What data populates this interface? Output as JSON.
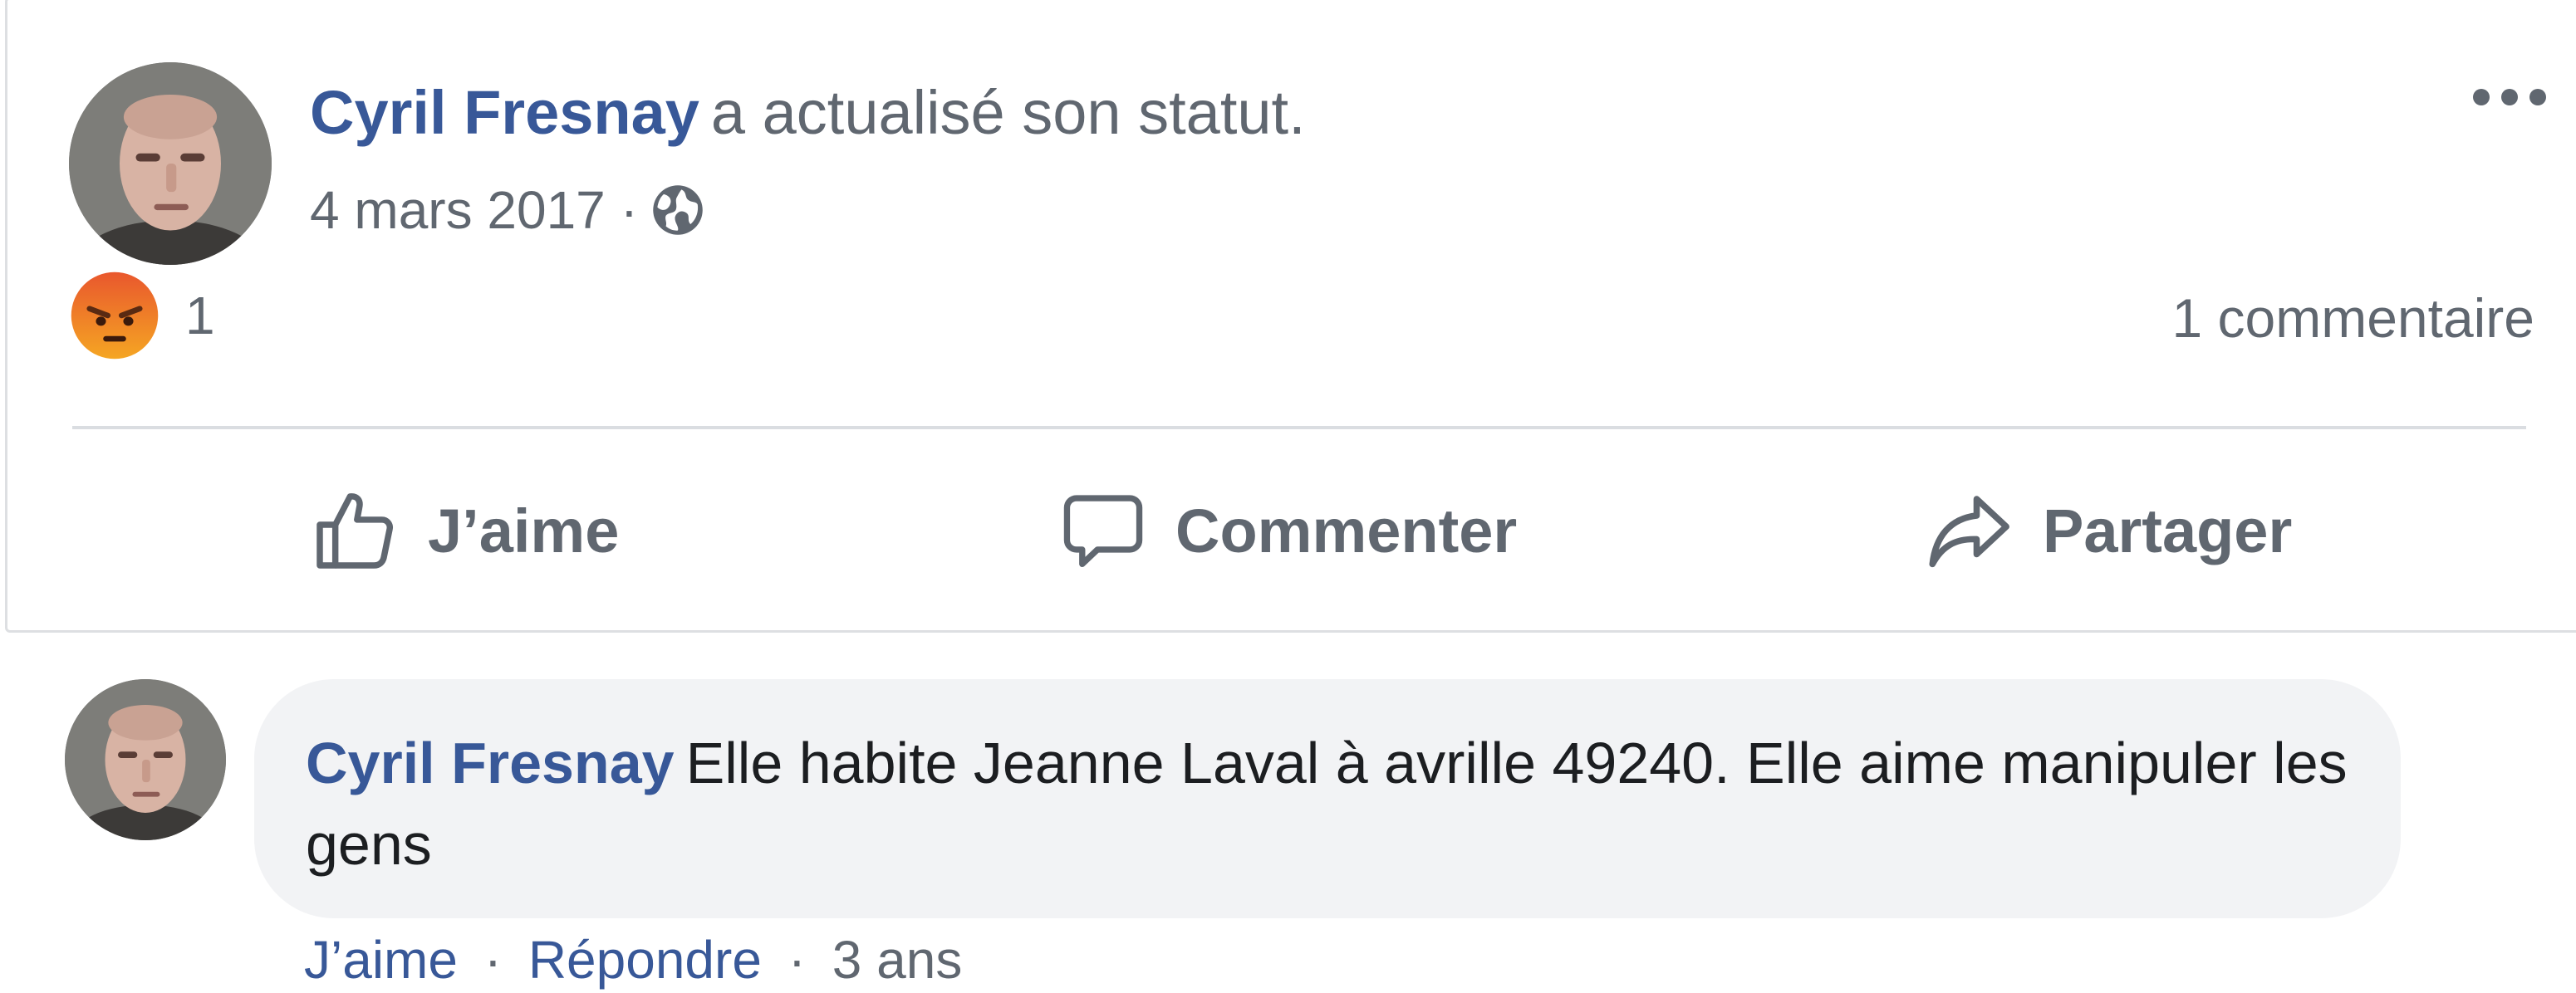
{
  "post": {
    "author": "Cyril Fresnay",
    "action_text": "a actualisé son statut.",
    "date": "4 mars 2017",
    "meta_separator": "·",
    "privacy_icon": "globe-icon",
    "more_icon": "more-horizontal-icon",
    "reaction_icon": "angry-reaction-icon",
    "reaction_count": "1",
    "comment_count": "1 commentaire"
  },
  "actions": {
    "like": "J’aime",
    "comment": "Commenter",
    "share": "Partager"
  },
  "comment": {
    "author": "Cyril Fresnay",
    "text": "Elle habite Jeanne Laval à avrille 49240. Elle aime manipuler les gens",
    "like": "J’aime",
    "reply": "Répondre",
    "age": "3 ans",
    "separator": "·"
  },
  "colors": {
    "link_blue": "#385898",
    "meta_gray": "#606770",
    "bubble_bg": "#f2f3f5",
    "angry_orange": "#f0641e"
  }
}
